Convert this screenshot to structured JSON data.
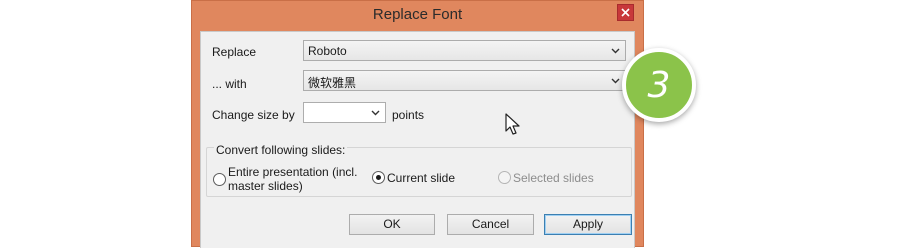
{
  "window": {
    "title": "Replace Font",
    "close_icon": "close-icon"
  },
  "form": {
    "replace_label": "Replace",
    "replace_value": "Roboto",
    "with_label": "... with",
    "with_value": "微软雅黑",
    "change_size_label": "Change size by",
    "change_size_value": "",
    "points_label": "points"
  },
  "convert_group": {
    "title": "Convert following slides:",
    "options": [
      {
        "label_line1": "Entire presentation (incl.",
        "label_line2": "master slides)",
        "selected": false,
        "enabled": true
      },
      {
        "label": "Current slide",
        "selected": true,
        "enabled": true
      },
      {
        "label": "Selected slides",
        "selected": false,
        "enabled": false
      }
    ]
  },
  "buttons": {
    "ok": "OK",
    "cancel": "Cancel",
    "apply": "Apply"
  },
  "annotation": {
    "step_number": "3",
    "badge_color": "#8bc34a"
  },
  "colors": {
    "window_frame": "#e0875e",
    "close_button": "#c8383a",
    "client_bg": "#f0f0f0"
  }
}
